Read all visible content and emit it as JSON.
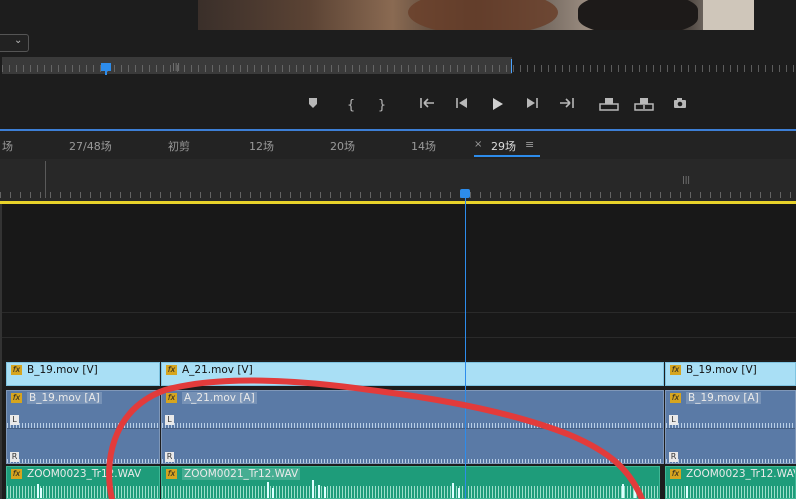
{
  "program_monitor": {
    "controls": [
      {
        "name": "add-marker-button",
        "glyph": "◆"
      },
      {
        "name": "mark-in-button",
        "glyph": "{"
      },
      {
        "name": "mark-out-button",
        "glyph": "}"
      },
      {
        "name": "go-to-in-button",
        "glyph": "{←"
      },
      {
        "name": "step-back-button",
        "glyph": "◀"
      },
      {
        "name": "play-button",
        "glyph": "▶"
      },
      {
        "name": "step-forward-button",
        "glyph": "▶"
      },
      {
        "name": "go-to-out-button",
        "glyph": "→}"
      },
      {
        "name": "lift-button",
        "glyph": "⫪"
      },
      {
        "name": "extract-button",
        "glyph": "⫫"
      },
      {
        "name": "export-frame-button",
        "glyph": "▣"
      }
    ],
    "monitor_playhead_icon": "playhead-icon"
  },
  "sequence_tabs": [
    "场",
    "27/48场",
    "初剪",
    "12场",
    "20场",
    "14场"
  ],
  "active_tab": {
    "close": "×",
    "label": "29场",
    "menu": "≡"
  },
  "clips": {
    "video": [
      {
        "label": "B_19.mov [V]"
      },
      {
        "label": "A_21.mov [V]"
      },
      {
        "label": "B_19.mov [V]"
      }
    ],
    "audio1": [
      {
        "label": "B_19.mov [A]"
      },
      {
        "label": "A_21.mov [A]"
      },
      {
        "label": "B_19.mov [A]"
      }
    ],
    "audio2": [
      {
        "label": "ZOOM0023_Tr12.WAV"
      },
      {
        "label": "ZOOM0021_Tr12.WAV"
      },
      {
        "label": "ZOOM0023_Tr12.WAV"
      }
    ],
    "fx_badge": "fx",
    "channel_left": "L",
    "channel_right": "R"
  },
  "colors": {
    "accent": "#2d8ceb",
    "work_area": "#e8d22a",
    "video_clip": "#a9dff5",
    "audio_clip": "#5a7aa6",
    "audio_clip_2": "#1e9c7a",
    "annotation": "#e23b3b"
  }
}
